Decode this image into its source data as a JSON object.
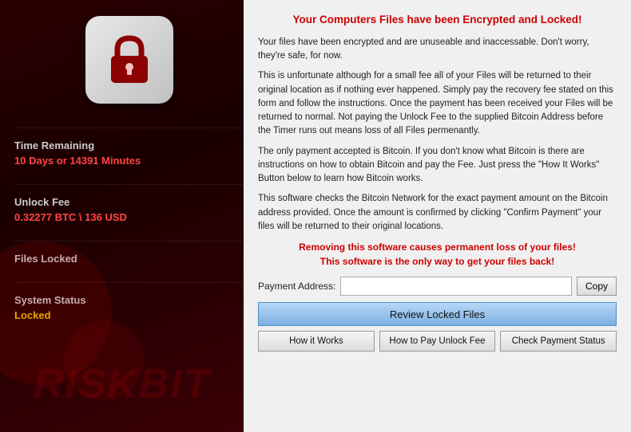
{
  "left": {
    "watermark": "RISKBIT",
    "lock_alt": "Lock Icon",
    "rows": [
      {
        "id": "time-remaining",
        "label": "Time Remaining",
        "value": "10 Days or 14391 Minutes",
        "value_class": "red"
      },
      {
        "id": "unlock-fee",
        "label": "Unlock Fee",
        "value": "0.32277 BTC \\ 136 USD",
        "value_class": "red"
      },
      {
        "id": "files-locked",
        "label": "Files Locked",
        "value": "",
        "value_class": "red"
      },
      {
        "id": "system-status",
        "label": "System Status",
        "value": "Locked",
        "value_class": "yellow"
      }
    ]
  },
  "right": {
    "title": "Your Computers Files have been Encrypted and Locked!",
    "paragraphs": [
      "Your files have been encrypted and are unuseable and inaccessable. Don't worry, they're safe, for now.",
      "This is unfortunate although for a small fee all of your Files will be returned to their original location as if nothing ever happened. Simply pay the recovery fee stated on this form and follow the instructions. Once the payment has been received your Files will be returned to normal. Not paying the Unlock Fee to the supplied Bitcoin Address before the Timer runs out means loss of all Files permenantly.",
      "The only payment accepted is Bitcoin. If you don't know what Bitcoin is there are instructions on how to obtain Bitcoin and pay the Fee. Just press the \"How It Works\" Button below to learn how Bitcoin works.",
      "This software checks the Bitcoin Network for the exact payment amount on the Bitcoin address provided. Once the amount is confirmed by clicking \"Confirm Payment\" your files will be returned to their original locations."
    ],
    "warning_lines": [
      "Removing this software causes permanent loss of your files!",
      "This software is the only way to get your files back!"
    ],
    "payment_label": "Payment Address:",
    "payment_placeholder": "",
    "copy_button": "Copy",
    "review_button": "Review Locked Files",
    "bottom_buttons": [
      "How it Works",
      "How to Pay Unlock Fee",
      "Check Payment Status"
    ]
  }
}
